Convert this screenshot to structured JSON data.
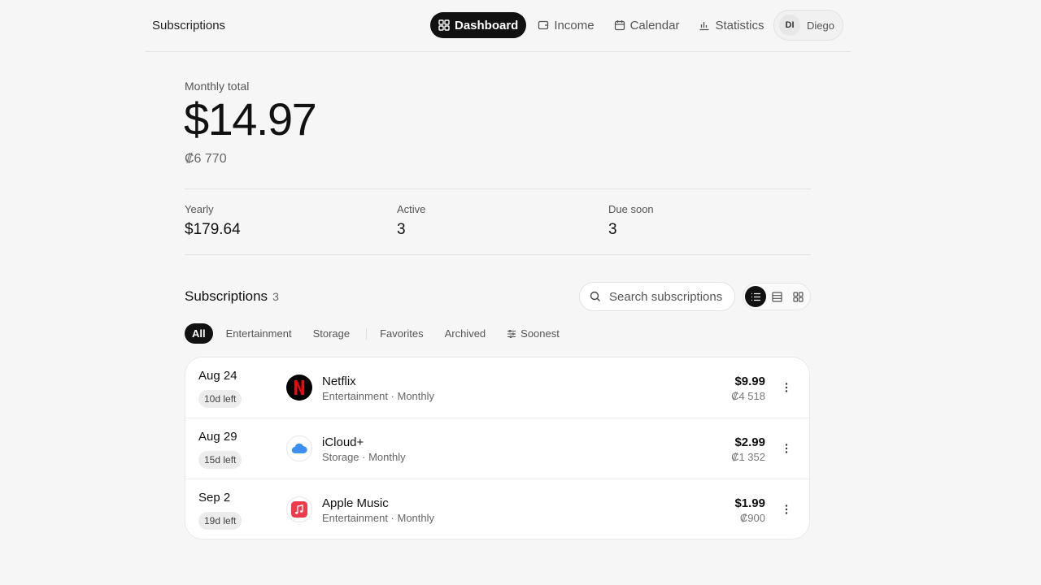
{
  "header": {
    "brand": "Subscriptions",
    "nav": [
      {
        "label": "Dashboard",
        "icon": "grid-icon"
      },
      {
        "label": "Income",
        "icon": "wallet-icon"
      },
      {
        "label": "Calendar",
        "icon": "calendar-icon"
      },
      {
        "label": "Statistics",
        "icon": "bar-chart-icon"
      }
    ],
    "user": {
      "initials": "DI",
      "name": "Diego"
    }
  },
  "summary": {
    "monthly_label": "Monthly total",
    "monthly_total": "$14.97",
    "monthly_local": "₡6 770",
    "stats": [
      {
        "label": "Yearly",
        "value": "$179.64"
      },
      {
        "label": "Active",
        "value": "3"
      },
      {
        "label": "Due soon",
        "value": "3"
      }
    ]
  },
  "subscriptions": {
    "title": "Subscriptions",
    "count": "3",
    "search_placeholder": "Search subscriptions",
    "filters": [
      "All",
      "Entertainment",
      "Storage",
      "Favorites",
      "Archived",
      "Soonest"
    ],
    "items": [
      {
        "date": "Aug 24",
        "left": "10d left",
        "name": "Netflix",
        "meta": "Entertainment · Monthly",
        "price": "$9.99",
        "local": "₡4 518",
        "logo": "netflix-logo",
        "color": "#e50914"
      },
      {
        "date": "Aug 29",
        "left": "15d left",
        "name": "iCloud+",
        "meta": "Storage · Monthly",
        "price": "$2.99",
        "local": "₡1 352",
        "logo": "cloud-icon",
        "color": "#3b8ff2"
      },
      {
        "date": "Sep 2",
        "left": "19d left",
        "name": "Apple Music",
        "meta": "Entertainment · Monthly",
        "price": "$1.99",
        "local": "₡900",
        "logo": "music-note-icon",
        "color": "#f0394a"
      }
    ]
  }
}
